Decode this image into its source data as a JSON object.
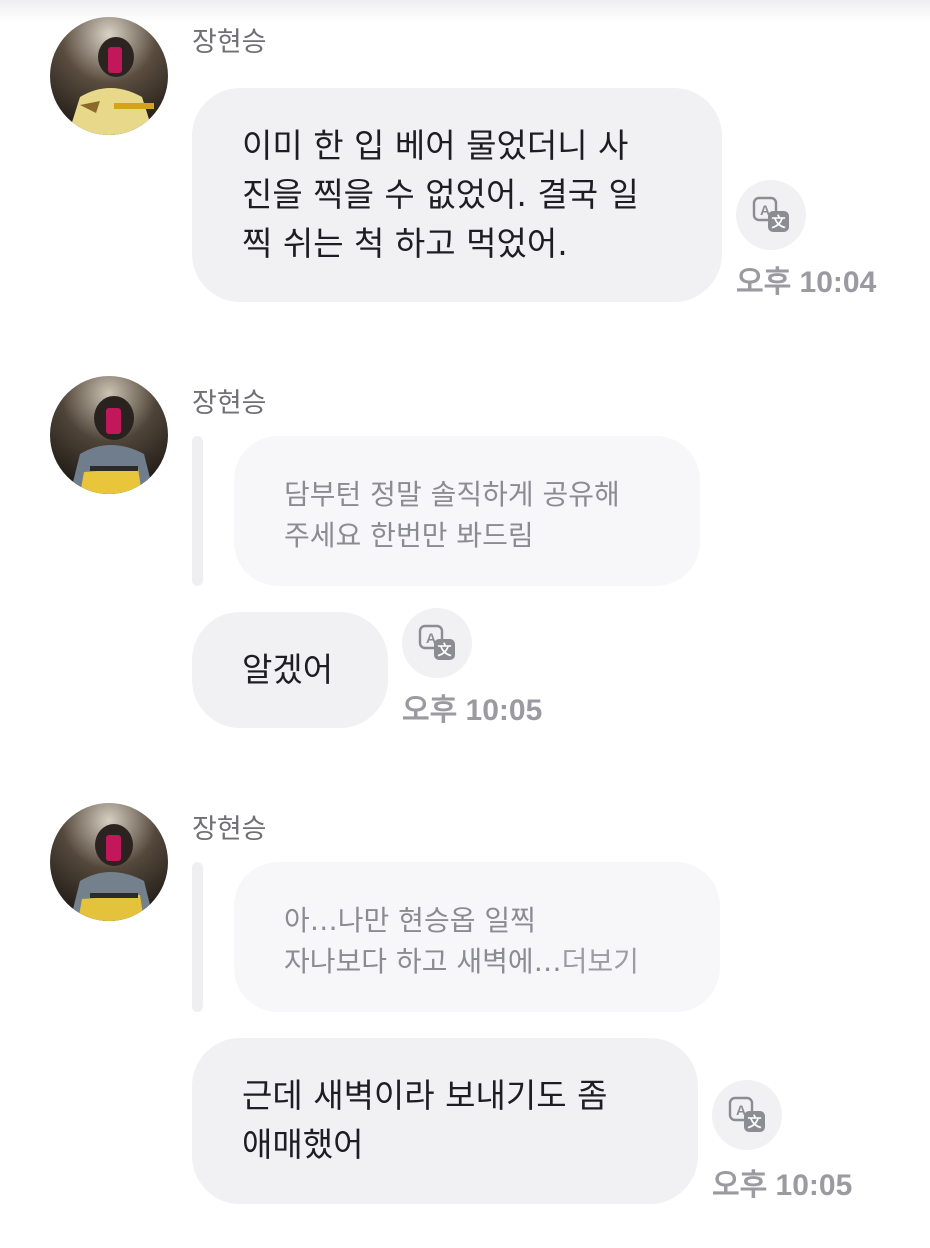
{
  "messages": [
    {
      "sender": "장현승",
      "text": "이미 한 입 베어 물었더니 사\n진을 찍을 수 없었어. 결국 일\n찍 쉬는 척 하고 먹었어.",
      "time": "오후 10:04"
    },
    {
      "sender": "장현승",
      "quote": "담부턴 정말 솔직하게 공유해\n주세요 한번만 봐드림",
      "text": "알겠어",
      "time": "오후 10:05"
    },
    {
      "sender": "장현승",
      "quote": "아…나만 현승옵 일찍\n자나보다 하고 새벽에…",
      "quote_more": "더보기",
      "text": "근데 새벽이라 보내기도 좀\n애매했어",
      "time": "오후 10:05"
    }
  ],
  "icons": {
    "avatar": "avatar-photo",
    "translate": "translate-icon"
  },
  "colors": {
    "bubble": "#f1f1f4",
    "quote_bubble": "#f7f7f9",
    "text": "#1d1d22",
    "muted": "#9a9aa0"
  }
}
